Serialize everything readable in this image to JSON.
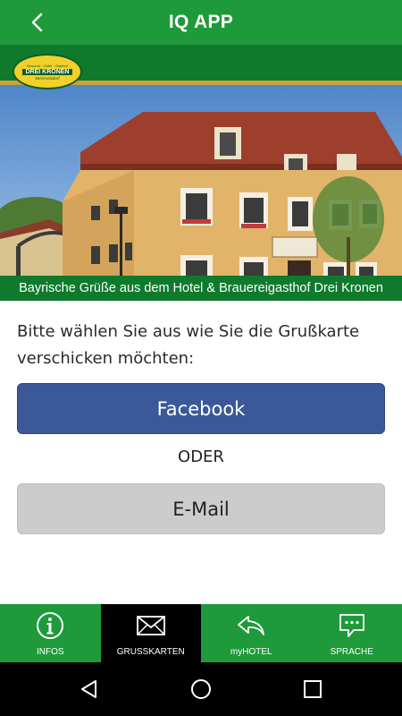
{
  "header": {
    "title": "IQ APP",
    "back_icon": "chevron-left-icon"
  },
  "hero": {
    "logo_line1": "Brauerei · Hotel · Gasthof",
    "logo_line2": "DREI KRONEN",
    "logo_line3": "Memmelsdorf",
    "caption": "Bayrische Grüße aus dem Hotel & Brauereigasthof Drei Kronen"
  },
  "content": {
    "instruction": "Bitte wählen Sie aus wie Sie die Grußkarte verschicken möchten:",
    "facebook_label": "Facebook",
    "separator": "ODER",
    "email_label": "E-Mail"
  },
  "bottom_nav": {
    "items": [
      {
        "label": "INFOS",
        "icon": "info-icon",
        "active": false
      },
      {
        "label": "GRUSSKARTEN",
        "icon": "envelope-icon",
        "active": true
      },
      {
        "label": "myHOTEL",
        "icon": "reply-arrow-icon",
        "active": false
      },
      {
        "label": "SPRACHE",
        "icon": "chat-bubble-icon",
        "active": false
      }
    ]
  },
  "system_nav": {
    "back_icon": "triangle-back-icon",
    "home_icon": "circle-home-icon",
    "recents_icon": "square-recents-icon"
  },
  "colors": {
    "brand_green": "#1e9a3a",
    "dark_green": "#0f7a2c",
    "facebook_blue": "#3b5998",
    "email_grey": "#cccccc",
    "active_tab": "#000000"
  }
}
